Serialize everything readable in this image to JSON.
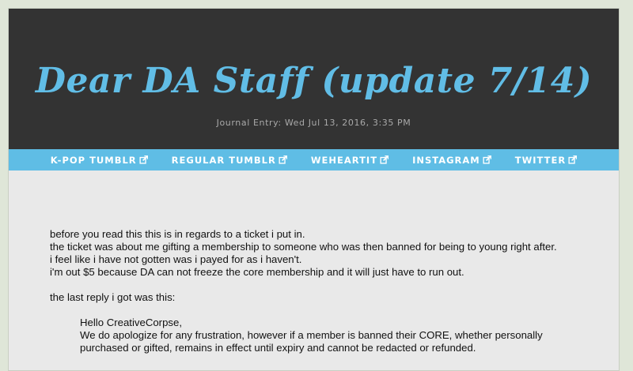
{
  "header": {
    "title": "Dear DA Staff (update 7/14)",
    "subtitle": "Journal Entry: Wed Jul 13, 2016, 3:35 PM"
  },
  "nav": {
    "items": [
      {
        "label": "K-POP TUMBLR",
        "icon": "external-link-icon"
      },
      {
        "label": "REGULAR TUMBLR",
        "icon": "external-link-icon"
      },
      {
        "label": "WEHEARTIT",
        "icon": "external-link-icon"
      },
      {
        "label": "INSTAGRAM",
        "icon": "external-link-icon"
      },
      {
        "label": "TWITTER",
        "icon": "external-link-icon"
      }
    ]
  },
  "body": {
    "lines": [
      "before you read this this is in regards to a ticket i put in.",
      "the ticket was about me gifting a membership to someone who was then banned for being to young right after.",
      "i feel like i have not gotten was i payed for as i haven't.",
      "i'm out $5 because DA can not freeze the core membership and it will just have to run out."
    ],
    "last_reply_intro": "the last reply i got was this:",
    "quote": {
      "greeting": "Hello CreativeCorpse,",
      "line1": "We do apologize for any frustration, however if a member is banned their CORE, whether personally",
      "line2": "purchased or gifted, remains in effect until expiry and cannot be redacted or refunded."
    }
  },
  "colors": {
    "header_bg": "#333333",
    "accent": "#61bde6",
    "nav_bg": "#5fbde5",
    "content_bg": "#e9e9e9"
  }
}
